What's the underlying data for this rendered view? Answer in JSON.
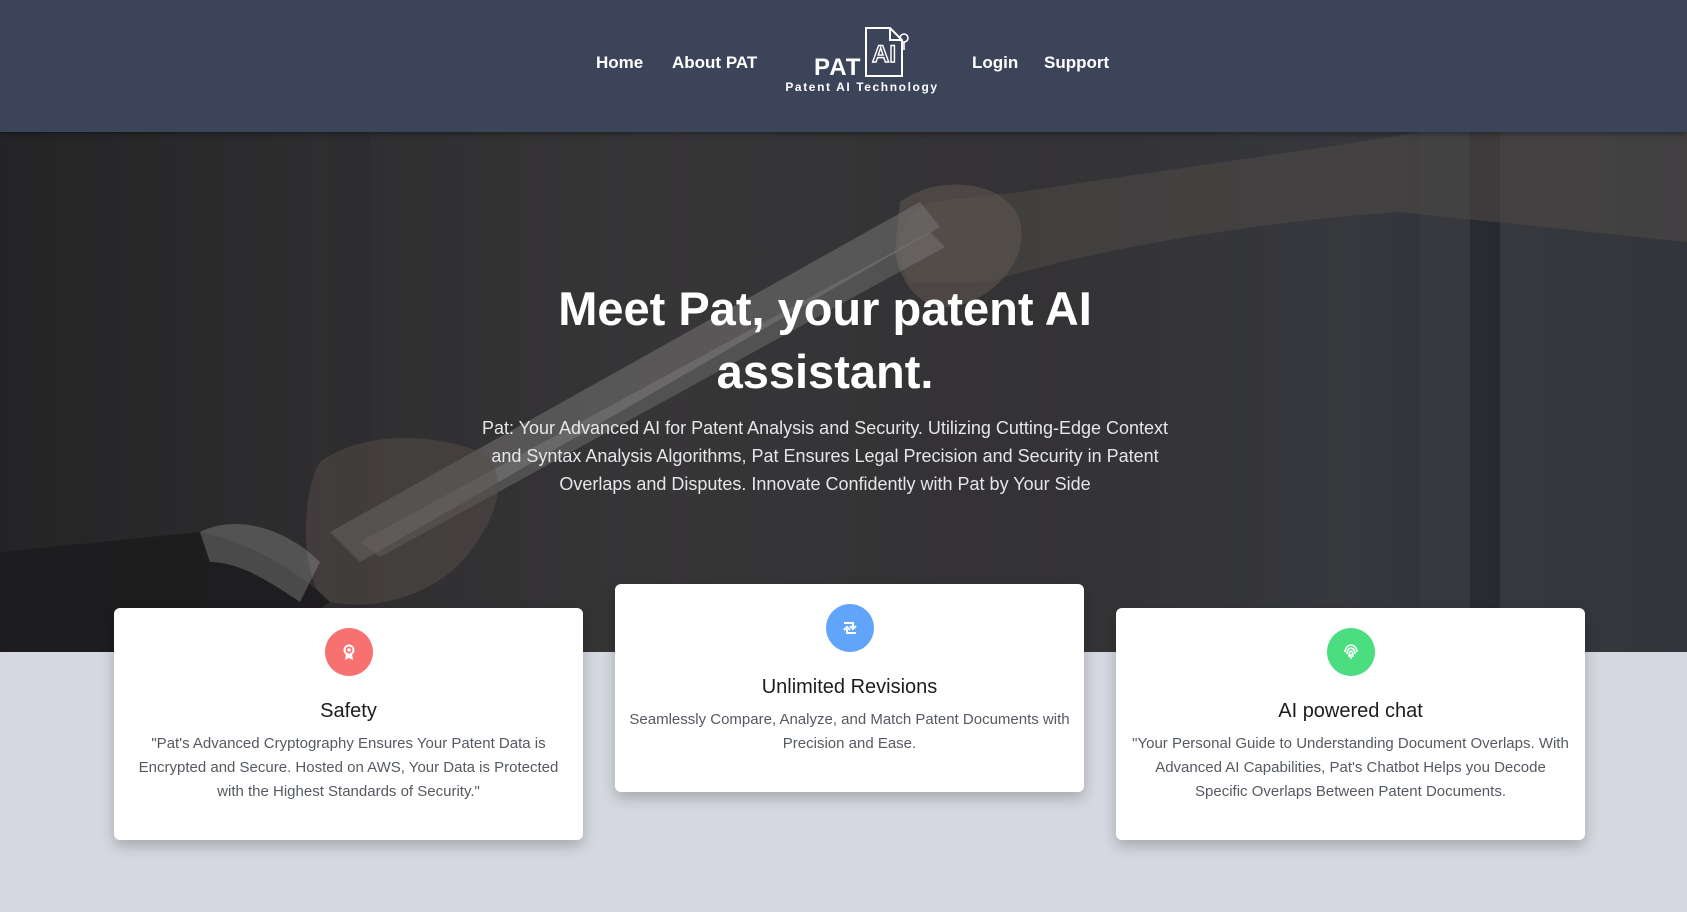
{
  "nav": {
    "home": "Home",
    "about": "About PAT",
    "login": "Login",
    "support": "Support",
    "logo_text": "PAT",
    "logo_mark": "AI",
    "logo_tagline": "Patent AI Technology"
  },
  "hero": {
    "title": "Meet Pat, your patent AI assistant.",
    "subtitle": "Pat: Your Advanced AI for Patent Analysis and Security. Utilizing Cutting-Edge Context and Syntax Analysis Algorithms, Pat Ensures Legal Precision and Security in Patent Overlaps and Disputes. Innovate Confidently with Pat by Your Side"
  },
  "features": [
    {
      "title": "Safety",
      "text": "\"Pat's Advanced Cryptography Ensures Your Patent Data is Encrypted and Secure. Hosted on AWS, Your Data is Protected with the Highest Standards of Security.\"",
      "icon": "award-icon",
      "color": "#f87171"
    },
    {
      "title": "Unlimited Revisions",
      "text": "Seamlessly Compare, Analyze, and Match Patent Documents with Precision and Ease.",
      "icon": "retweet-icon",
      "color": "#60a5fa"
    },
    {
      "title": "AI powered chat",
      "text": "\"Your Personal Guide to Understanding Document Overlaps. With Advanced AI Capabilities, Pat's Chatbot Helps you Decode Specific Overlaps Between Patent Documents.",
      "icon": "fingerprint-icon",
      "color": "#4ade80"
    }
  ],
  "colors": {
    "navbar": "#3b4458",
    "page_background": "#d5d8e0"
  }
}
